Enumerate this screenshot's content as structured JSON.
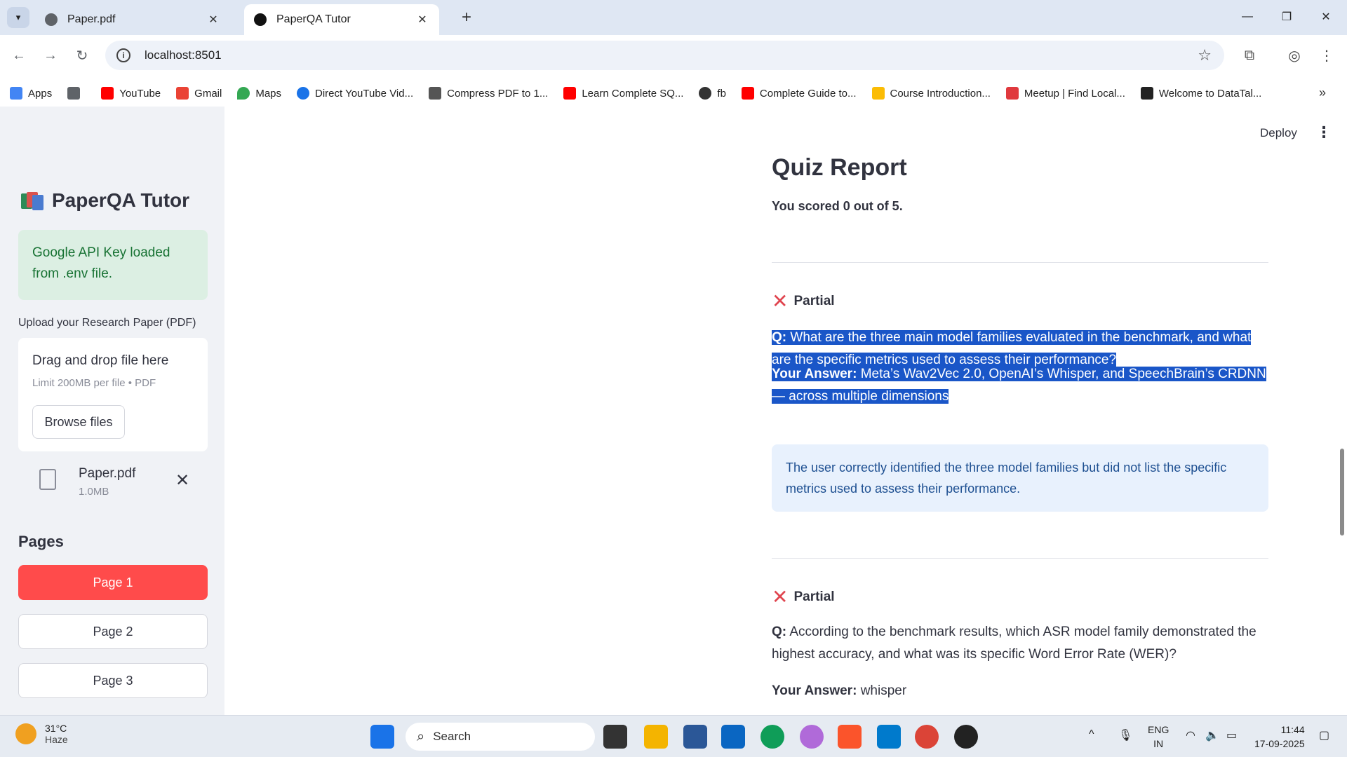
{
  "browser": {
    "tabs": [
      {
        "title": "Paper.pdf",
        "close": "✕"
      },
      {
        "title": "PaperQA Tutor",
        "close": "✕"
      }
    ],
    "new_tab": "+",
    "window_controls": {
      "minimize": "—",
      "restore": "❐",
      "close": "✕"
    },
    "url": "localhost:8501",
    "bookmarks": [
      {
        "label": "Apps",
        "color": "#4285f4"
      },
      {
        "label": "",
        "color": "#5f6368"
      },
      {
        "label": "YouTube",
        "color": "#ff0000"
      },
      {
        "label": "Gmail",
        "color": "#ea4335"
      },
      {
        "label": "Maps",
        "color": "#34a853"
      },
      {
        "label": "Direct YouTube Vid...",
        "color": "#1a73e8"
      },
      {
        "label": "Compress PDF to 1...",
        "color": "#555555"
      },
      {
        "label": "Learn Complete SQ...",
        "color": "#ff0000"
      },
      {
        "label": "fb",
        "color": "#333333"
      },
      {
        "label": "Complete Guide to...",
        "color": "#ff0000"
      },
      {
        "label": "Course Introduction...",
        "color": "#fbbc04"
      },
      {
        "label": "Meetup | Find Local...",
        "color": "#e0393e"
      },
      {
        "label": "Welcome to DataTal...",
        "color": "#222222"
      }
    ],
    "more": "»"
  },
  "sidebar": {
    "brand": "PaperQA Tutor",
    "success_message": "Google API Key loaded from .env file.",
    "upload_label": "Upload your Research Paper (PDF)",
    "dropzone_title": "Drag and drop file here",
    "dropzone_limit": "Limit 200MB per file • PDF",
    "browse_label": "Browse files",
    "file": {
      "name": "Paper.pdf",
      "size": "1.0MB"
    },
    "pages_title": "Pages",
    "pages": [
      "Page 1",
      "Page 2",
      "Page 3"
    ]
  },
  "header": {
    "deploy": "Deploy",
    "menu": "⋮"
  },
  "report": {
    "title": "Quiz Report",
    "score_text": "You scored 0 out of 5.",
    "items": [
      {
        "status": "Partial",
        "q_prefix": "Q:",
        "question": "What are the three main model families evaluated in the benchmark, and what are the specific metrics used to assess their performance?",
        "answer_prefix": "Your Answer:",
        "answer": "Meta’s Wav2Vec 2.0, OpenAI’s Whisper, and SpeechBrain’s CRDNN — across multiple dimensions",
        "feedback": "The user correctly identified the three model families but did not list the specific metrics used to assess their performance."
      },
      {
        "status": "Partial",
        "q_prefix": "Q:",
        "question": "According to the benchmark results, which ASR model family demonstrated the highest accuracy, and what was its specific Word Error Rate (WER)?",
        "answer_prefix": "Your Answer:",
        "answer": "whisper"
      }
    ]
  },
  "taskbar": {
    "weather_temp": "31°C",
    "weather_desc": "Haze",
    "search": "Search",
    "lang1": "ENG",
    "lang2": "IN",
    "time": "11:44",
    "date": "17-09-2025"
  }
}
